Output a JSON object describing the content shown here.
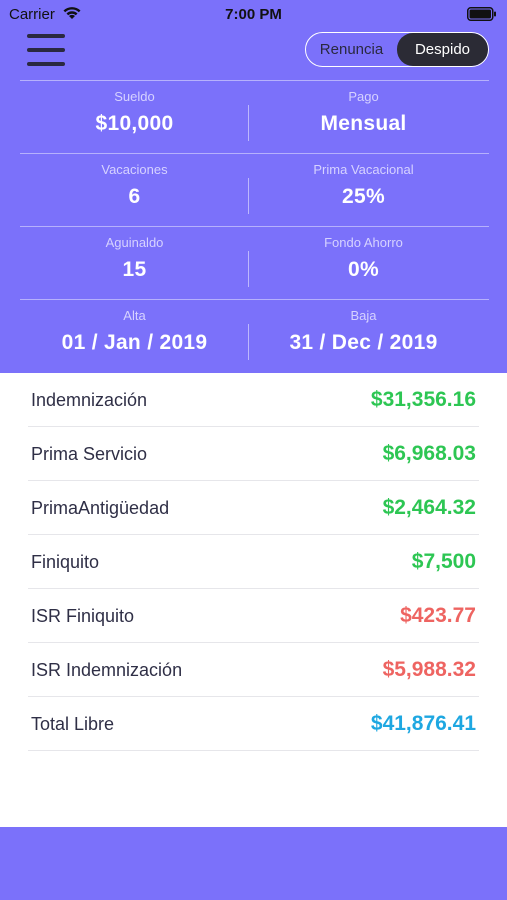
{
  "status_bar": {
    "carrier": "Carrier",
    "time": "7:00 PM"
  },
  "header": {
    "segmented": {
      "options": [
        "Renuncia",
        "Despido"
      ],
      "selected": "Despido"
    }
  },
  "stats": {
    "rows": [
      {
        "left": {
          "label": "Sueldo",
          "value": "$10,000"
        },
        "right": {
          "label": "Pago",
          "value": "Mensual"
        }
      },
      {
        "left": {
          "label": "Vacaciones",
          "value": "6"
        },
        "right": {
          "label": "Prima Vacacional",
          "value": "25%"
        }
      },
      {
        "left": {
          "label": "Aguinaldo",
          "value": "15"
        },
        "right": {
          "label": "Fondo Ahorro",
          "value": "0%"
        }
      },
      {
        "left": {
          "label": "Alta",
          "value": "01 / Jan / 2019"
        },
        "right": {
          "label": "Baja",
          "value": "31 / Dec / 2019"
        }
      }
    ]
  },
  "results": {
    "rows": [
      {
        "label": "Indemnización",
        "value": "$31,356.16",
        "color": "#2DC653"
      },
      {
        "label": "Prima Servicio",
        "value": "$6,968.03",
        "color": "#2DC653"
      },
      {
        "label": "PrimaAntigüedad",
        "value": "$2,464.32",
        "color": "#2DC653"
      },
      {
        "label": "Finiquito",
        "value": "$7,500",
        "color": "#2DC653"
      },
      {
        "label": "ISR Finiquito",
        "value": "$423.77",
        "color": "#EE6461"
      },
      {
        "label": "ISR Indemnización",
        "value": "$5,988.32",
        "color": "#EE6461"
      },
      {
        "label": "Total Libre",
        "value": "$41,876.41",
        "color": "#1EA7E1"
      }
    ]
  },
  "colors": {
    "background": "#7B71FA",
    "card": "#FFFFFF",
    "positive": "#2DC653",
    "negative": "#EE6461",
    "total": "#1EA7E1",
    "segment_active": "#2B2B35"
  }
}
